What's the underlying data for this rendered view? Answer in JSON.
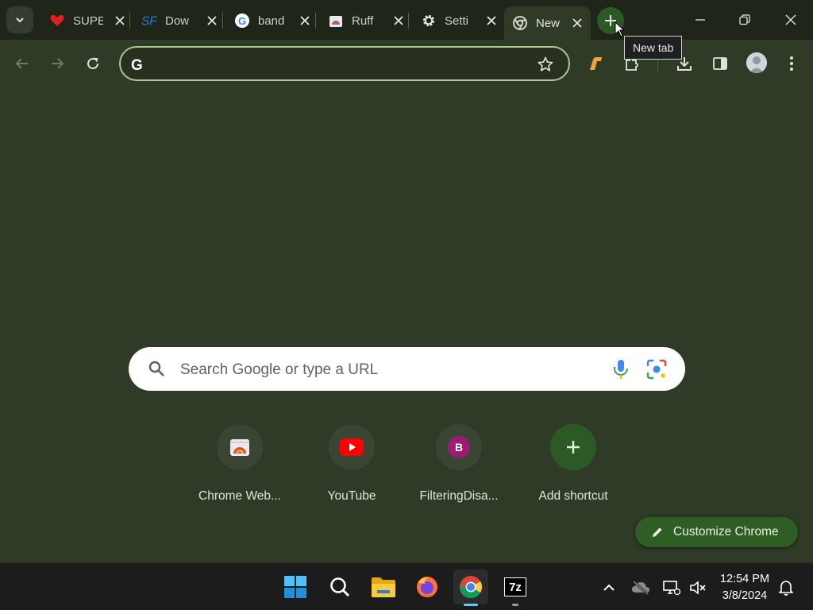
{
  "browser": {
    "tabs": [
      {
        "title": "SUPE",
        "favicon": "heart-icon",
        "active": false
      },
      {
        "title": "Dow",
        "favicon": "sf-logo-icon",
        "active": false
      },
      {
        "title": "band",
        "favicon": "google-g-icon",
        "active": false
      },
      {
        "title": "Ruff",
        "favicon": "web-store-icon",
        "active": false
      },
      {
        "title": "Setti",
        "favicon": "gear-icon",
        "active": false
      },
      {
        "title": "New",
        "favicon": "chrome-icon",
        "active": true
      }
    ],
    "new_tab_tooltip": "New tab",
    "omnibox": {
      "value": "",
      "placeholder": ""
    }
  },
  "ntp": {
    "search_placeholder": "Search Google or type a URL",
    "shortcuts": [
      {
        "label": "Chrome Web...",
        "icon": "chrome-web-store-icon"
      },
      {
        "label": "YouTube",
        "icon": "youtube-icon"
      },
      {
        "label": "FilteringDisa...",
        "icon": "letter-b-icon",
        "letter": "B"
      },
      {
        "label": "Add shortcut",
        "icon": "plus-icon"
      }
    ],
    "customize_label": "Customize Chrome"
  },
  "taskbar": {
    "apps": [
      "windows-start-icon",
      "search-icon",
      "file-explorer-icon",
      "firefox-icon",
      "chrome-icon",
      "7zip-icon"
    ],
    "sevenzip_label": "7z",
    "time": "12:54 PM",
    "date": "3/8/2024"
  },
  "colors": {
    "page_bg": "#2f3a27",
    "tabstrip_bg": "#1f2619",
    "accent_green": "#2f5e25",
    "omnibox_border": "#a9c98f"
  }
}
